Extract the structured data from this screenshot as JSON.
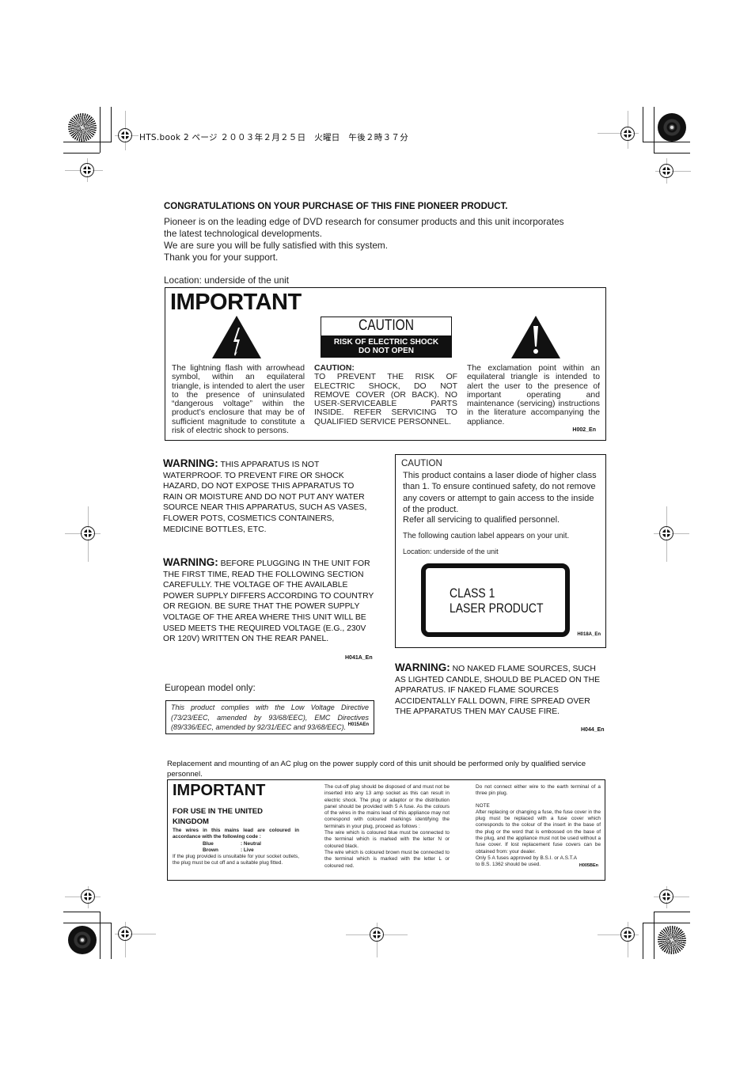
{
  "print_header": "HTS.book  2 ページ  ２００３年２月２５日　火曜日　午後２時３７分",
  "intro": {
    "title": "CONGRATULATIONS ON YOUR PURCHASE OF THIS FINE PIONEER PRODUCT.",
    "lines": [
      "Pioneer is on the leading edge of DVD research for consumer products and this unit incorporates",
      "the latest technological developments.",
      "We are sure you will be fully satisfied with this system.",
      "Thank you for your support."
    ]
  },
  "important_box": {
    "location": "Location: underside of the unit",
    "title": "IMPORTANT",
    "caution_label_top": "CAUTION",
    "caution_label_bottom_1": "RISK OF ELECTRIC SHOCK",
    "caution_label_bottom_2": "DO NOT OPEN",
    "lightning_icon": "lightning-warning-triangle",
    "exclamation_icon": "exclamation-warning-triangle",
    "left_text": "The lightning flash with arrowhead symbol, within an equilateral triangle, is intended to alert the user to the presence of uninsulated “dangerous voltage” within the product’s enclosure that may be of sufficient magnitude to constitute a risk of electric shock to persons.",
    "center_heading": "CAUTION:",
    "center_text": "TO PREVENT THE RISK OF ELECTRIC SHOCK, DO NOT REMOVE COVER (OR BACK). NO USER-SERVICEABLE PARTS INSIDE. REFER SERVICING TO QUALIFIED SERVICE PERSONNEL.",
    "right_text": "The exclamation point within an equilateral triangle is intended to alert the user to the presence of important operating and maintenance (servicing) instructions in the literature accompanying the appliance.",
    "code": "H002_En"
  },
  "warning_water": {
    "label": "WARNING:",
    "text": " THIS APPARATUS IS NOT WATERPROOF. TO PREVENT FIRE OR SHOCK HAZARD, DO NOT EXPOSE THIS APPARATUS TO RAIN OR MOISTURE AND DO NOT PUT ANY WATER SOURCE NEAR THIS APPARATUS, SUCH AS VASES, FLOWER POTS, COSMETICS CONTAINERS, MEDICINE BOTTLES, ETC."
  },
  "warning_power": {
    "label": "WARNING:",
    "text": " BEFORE PLUGGING IN THE UNIT FOR THE FIRST TIME, READ THE FOLLOWING SECTION CAREFULLY. THE VOLTAGE OF THE AVAILABLE POWER SUPPLY DIFFERS ACCORDING TO COUNTRY OR REGION. BE SURE THAT THE POWER SUPPLY VOLTAGE OF THE AREA WHERE THIS UNIT WILL BE USED MEETS THE REQUIRED VOLTAGE (E.G., 230V OR 120V) WRITTEN ON THE REAR PANEL.",
    "code": "H041A_En"
  },
  "laser_box": {
    "heading": "CAUTION",
    "text": "This product contains a laser diode of higher class than 1. To ensure continued safety, do not remove any covers or attempt to gain access to the inside of the product.",
    "refer": "Refer all servicing to qualified personnel.",
    "following": "The following caution label appears on your unit.",
    "location": "Location: underside of the unit",
    "label_line1": "CLASS 1",
    "label_line2": "LASER PRODUCT",
    "code": "H018A_En"
  },
  "warning_flame": {
    "label": "WARNING:",
    "text": " NO NAKED FLAME SOURCES, SUCH AS LIGHTED CANDLE, SHOULD BE PLACED ON THE APPARATUS. IF NAKED FLAME SOURCES ACCIDENTALLY FALL DOWN, FIRE SPREAD OVER THE APPARATUS THEN MAY CAUSE FIRE.",
    "code": "H044_En"
  },
  "european": {
    "label": "European model only:",
    "text": "This product complies with the Low Voltage Directive (73/23/EEC, amended by 93/68/EEC), EMC Directives (89/336/EEC, amended by 92/31/EEC and 93/68/EEC).",
    "code": "H015AEn"
  },
  "ac_plug_note": "Replacement and mounting of an AC plug on the power supply cord of this unit should be performed only by qualified service personnel.",
  "uk_box": {
    "title": "IMPORTANT",
    "subtitle": "FOR USE IN THE UNITED KINGDOM",
    "wires_intro": "The wires in this mains lead are coloured in accordance with the following code :",
    "wires": [
      {
        "color": "Blue",
        "meaning": ": Neutral"
      },
      {
        "color": "Brown",
        "meaning": ": Live"
      }
    ],
    "unsuitable": "If the plug provided is unsuitable for your socket outlets, the plug must be cut off and a suitable plug fitted.",
    "middle_1": "The cut-off plug should be disposed of and must not be inserted into any 13 amp socket as this can result in electric shock. The plug or adaptor or the distribution panel should be provided with 5 A fuse. As the colours of the wires in the mains lead of this appliance may not correspond with coloured markings identifying the terminals in your plug, proceed as follows :",
    "middle_2": "The wire which is coloured blue must be connected to the terminal which is marked with the letter N or coloured black.",
    "middle_3": "The wire which is coloured brown must be connected to the terminal which is marked with the letter L or coloured red.",
    "right_1": "Do not connect either wire to the earth terminal of a three pin plug.",
    "note_label": "NOTE",
    "right_2": "After replacing or changing a fuse, the fuse cover in the plug must be replaced with a fuse cover which corresponds to the colour of the insert in the base of the plug or the word that is embossed on the base of the plug, and the appliance must not be used without a fuse cover. If lost replacement fuse covers can be obtained from: your dealer.",
    "right_3": "Only 5 A fuses approved by B.S.I. or A.S.T.A to B.S. 1362 should be used.",
    "code": "H005BEn"
  }
}
